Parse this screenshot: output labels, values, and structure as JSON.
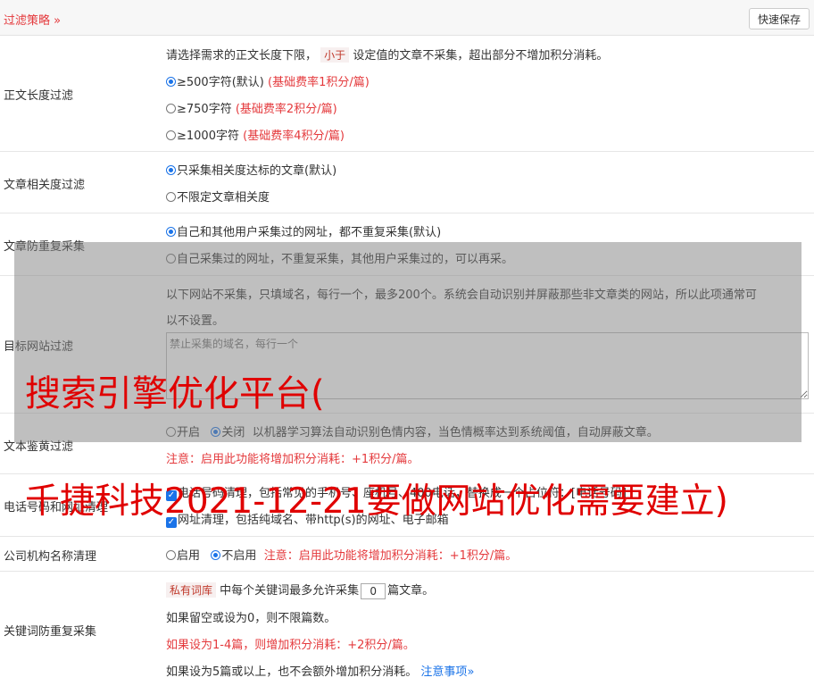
{
  "topbar": {
    "title": "过滤策略",
    "title_icon": "double-chevron-down-icon",
    "save_label": "快速保存"
  },
  "length_filter": {
    "label": "正文长度过滤",
    "desc_pre": "请选择需求的正文长度下限，",
    "desc_tag": "小于",
    "desc_post": "设定值的文章不采集，超出部分不增加积分消耗。",
    "options": [
      {
        "label": "≥500字符(默认)",
        "note": "(基础费率1积分/篇)",
        "selected": true
      },
      {
        "label": "≥750字符",
        "note": "(基础费率2积分/篇)",
        "selected": false
      },
      {
        "label": "≥1000字符",
        "note": "(基础费率4积分/篇)",
        "selected": false
      }
    ]
  },
  "relevance_filter": {
    "label": "文章相关度过滤",
    "options": [
      {
        "label": "只采集相关度达标的文章(默认)",
        "selected": true
      },
      {
        "label": "不限定文章相关度",
        "selected": false
      }
    ]
  },
  "dedupe": {
    "label": "文章防重复采集",
    "options": [
      {
        "label": "自己和其他用户采集过的网址，都不重复采集(默认)",
        "selected": true
      },
      {
        "label": "自己采集过的网址，不重复采集，其他用户采集过的，可以再采。",
        "selected": false
      }
    ]
  },
  "site_filter": {
    "label": "目标网站过滤",
    "desc_line1": "以下网站不采集，只填域名，每行一个，最多200个。系统会自动识别并屏蔽那些非文章类的网站，所以此项通常可",
    "desc_line2": "以不设置。",
    "placeholder": "禁止采集的域名，每行一个"
  },
  "porn_filter": {
    "label": "文本鉴黄过滤",
    "opt_on": "开启",
    "opt_off": "关闭",
    "selected": "关闭",
    "desc": "以机器学习算法自动识别色情内容，当色情概率达到系统阈值，自动屏蔽文章。",
    "note": "注意：启用此功能将增加积分消耗：+1积分/篇。"
  },
  "contact_clean": {
    "label": "电话号码和网址清理",
    "phone_label": "电话号码清理，包括常见的手机号、座机号、400电话，替换成一个占位符：[电话号码]",
    "url_label": "网址清理，包括纯域名、带http(s)的网址、电子邮箱"
  },
  "org_clean": {
    "label": "公司机构名称清理",
    "opt_on": "启用",
    "opt_off": "不启用",
    "selected": "不启用",
    "note": "注意：启用此功能将增加积分消耗：+1积分/篇。"
  },
  "keyword_dedupe": {
    "label": "关键词防重复采集",
    "tag": "私有词库",
    "line1_mid": "中每个关键词最多允许采集",
    "value": "0",
    "line1_post": "篇文章。",
    "line2": "如果留空或设为0，则不限篇数。",
    "line3": "如果设为1-4篇，则增加积分消耗：+2积分/篇。",
    "line4": "如果设为5篇或以上，也不会额外增加积分消耗。",
    "link": "注意事项",
    "link_icon": "double-chevron-down-icon"
  },
  "watermark": {
    "line1": "搜索引擎优化平台(",
    "line2": "千捷科技2021-12-21要做网站优化需要建立)"
  },
  "colors": {
    "accent_red": "#e4393c",
    "link_blue": "#1a73e8",
    "watermark_red": "#e00000"
  }
}
